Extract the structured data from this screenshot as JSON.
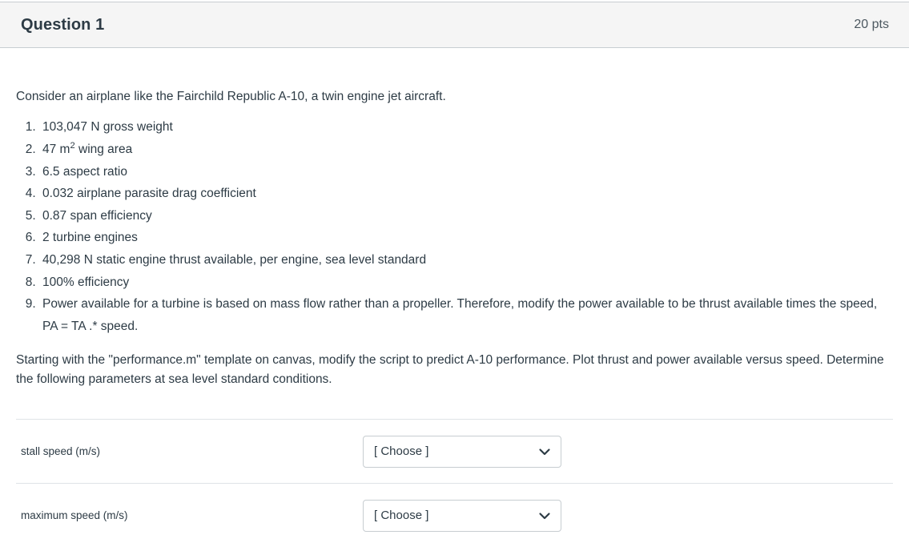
{
  "header": {
    "question_name": "Question 1",
    "points": "20 pts",
    "background_color": "#f5f5f5",
    "border_color": "#c7cdd1",
    "text_color": "#2d3b45"
  },
  "body": {
    "intro": "Consider an airplane like the Fairchild Republic A-10, a twin engine jet aircraft.",
    "spec_list": [
      {
        "text": "103,047 N gross weight"
      },
      {
        "text_before": "47 m",
        "superscript": "2",
        "text_after": " wing area"
      },
      {
        "text": "6.5 aspect ratio"
      },
      {
        "text": "0.032 airplane parasite drag coefficient"
      },
      {
        "text": "0.87 span efficiency"
      },
      {
        "text": "2 turbine engines"
      },
      {
        "text": "40,298 N static engine thrust available, per engine, sea level standard"
      },
      {
        "text": "100%  efficiency"
      },
      {
        "text": "Power available for a turbine is based on mass flow rather than a propeller.  Therefore, modify the power available to be thrust available times the speed, PA = TA  .* speed."
      }
    ],
    "task": "Starting with the \"performance.m\" template on canvas, modify the script to predict A-10 performance.  Plot thrust and power available versus speed.  Determine the following parameters at sea level standard conditions."
  },
  "answers": {
    "rows": [
      {
        "label": "stall speed (m/s)",
        "selected": "[ Choose ]",
        "icon": "chevron-down-icon"
      },
      {
        "label": "maximum speed (m/s)",
        "selected": "[ Choose ]",
        "icon": "chevron-down-icon"
      }
    ],
    "divider_color": "#dfe3e7",
    "select_border_color": "#c7cdd1"
  }
}
